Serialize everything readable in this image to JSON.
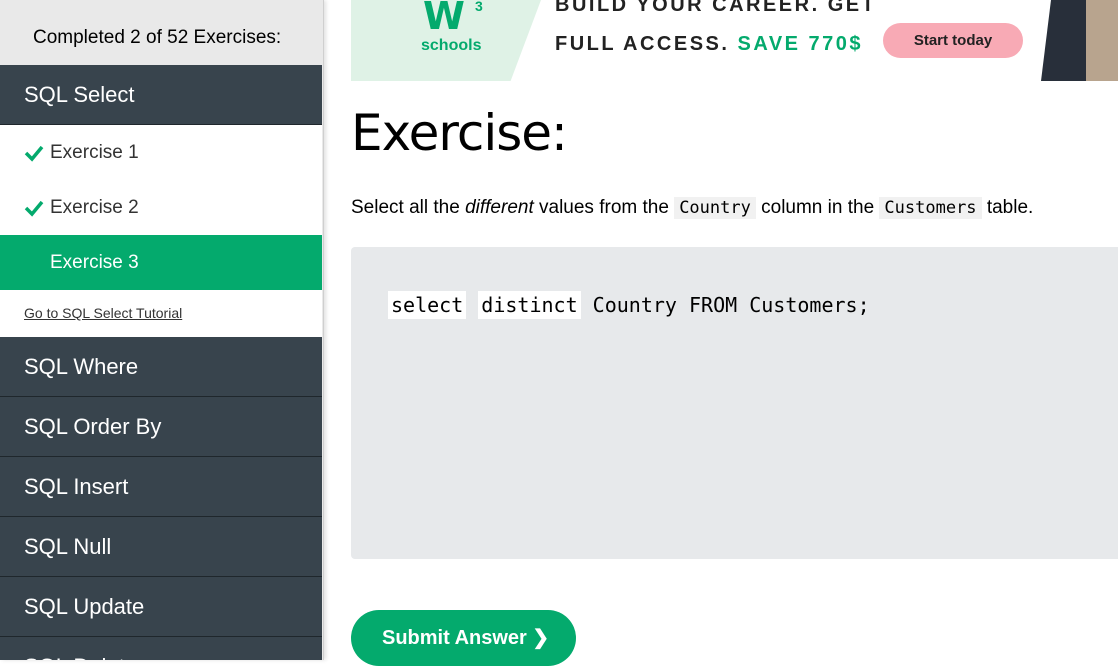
{
  "sidebar": {
    "progress_text": "Completed 2 of 52 Exercises:",
    "active_category": "SQL Select",
    "exercises": [
      {
        "label": "Exercise 1",
        "completed": true
      },
      {
        "label": "Exercise 2",
        "completed": true
      },
      {
        "label": "Exercise 3",
        "completed": false,
        "current": true
      }
    ],
    "tutorial_link": "Go to SQL Select Tutorial",
    "categories": [
      "SQL Where",
      "SQL Order By",
      "SQL Insert",
      "SQL Null",
      "SQL Update",
      "SQL Delete"
    ]
  },
  "banner": {
    "logo_mark": "W",
    "logo_superscript": "3",
    "logo_text": "schools",
    "line1": "BUILD YOUR CAREER. GET",
    "line2_prefix": "FULL ACCESS.",
    "line2_highlight": "SAVE 770$",
    "cta": "Start today"
  },
  "main": {
    "heading": "Exercise:",
    "instruction": {
      "part1": "Select all the ",
      "emphasis": "different",
      "part2": " values from the ",
      "code1": "Country",
      "part3": " column in the ",
      "code2": "Customers",
      "part4": " table."
    },
    "code": {
      "input1": "select",
      "input2": "distinct",
      "rest": " Country FROM Customers;"
    },
    "submit_label": "Submit Answer ❯"
  },
  "colors": {
    "accent": "#04aa6d",
    "sidebar_dark": "#38444d",
    "editor_bg": "#e7e9eb",
    "cta_pink": "#f8aab5"
  }
}
